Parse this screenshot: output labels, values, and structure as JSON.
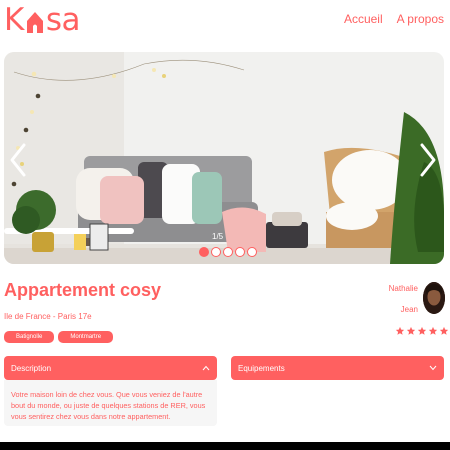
{
  "header": {
    "logo": {
      "text_left": "K",
      "text_right": "sa"
    },
    "nav": [
      {
        "label": "Accueil"
      },
      {
        "label": "A propos"
      }
    ]
  },
  "carousel": {
    "counter": "1/5",
    "total": 5,
    "active_index": 0,
    "prev_icon": "chevron-left-icon",
    "next_icon": "chevron-right-icon"
  },
  "listing": {
    "title": "Appartement cosy",
    "location": "Ile de France - Paris 17e",
    "tags": [
      "Batignolle",
      "Montmartre"
    ],
    "rating": 5,
    "rating_max": 5
  },
  "host": {
    "first_name": "Nathalie",
    "last_name": "Jean"
  },
  "collapses": {
    "description": {
      "label": "Description",
      "icon": "chevron-up-icon",
      "text": "Votre maison loin de chez vous. Que vous veniez de l'autre bout du monde, ou juste de quelques stations de RER, vous vous sentirez chez vous dans notre appartement."
    },
    "equipment": {
      "label": "Equipements",
      "icon": "chevron-down-icon"
    }
  },
  "colors": {
    "accent": "#FF6060",
    "panel": "#F6F6F6",
    "star_empty": "#E3E3E3"
  }
}
